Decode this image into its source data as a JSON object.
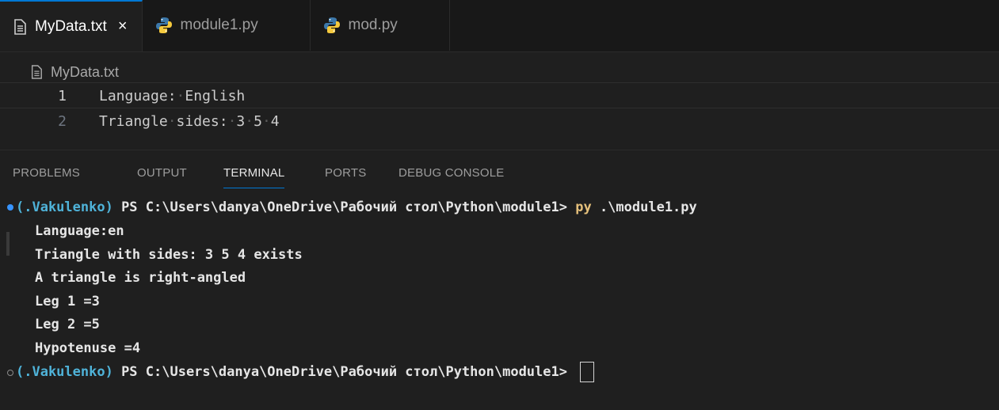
{
  "tabs": [
    {
      "label": "MyData.txt",
      "icon": "file-text-icon",
      "active": true,
      "close": "×"
    },
    {
      "label": "module1.py",
      "icon": "python-icon",
      "active": false
    },
    {
      "label": "mod.py",
      "icon": "python-icon",
      "active": false
    }
  ],
  "breadcrumb": {
    "file": "MyData.txt",
    "icon": "file-text-icon"
  },
  "editor": {
    "lines": [
      {
        "number": "1",
        "text": "Language: English"
      },
      {
        "number": "2",
        "text": "Triangle sides: 3 5 4"
      }
    ]
  },
  "panel": {
    "tabs": [
      "PROBLEMS",
      "OUTPUT",
      "TERMINAL",
      "PORTS",
      "DEBUG CONSOLE"
    ],
    "active_tab": "TERMINAL"
  },
  "terminal": {
    "prompt1": {
      "venv": "(.Vakulenko)",
      "path": " PS C:\\Users\\danya\\OneDrive\\Рабочий стол\\Python\\module1> ",
      "cmd": "py",
      "args": " .\\module1.py"
    },
    "output": [
      "Language:en",
      "Triangle with sides: 3 5 4 exists",
      "A triangle is right-angled",
      "Leg 1 =3",
      "Leg 2 =5",
      "Hypotenuse =4"
    ],
    "prompt2": {
      "venv": "(.Vakulenko)",
      "path": " PS C:\\Users\\danya\\OneDrive\\Рабочий стол\\Python\\module1> "
    }
  },
  "colors": {
    "accent": "#0078d4",
    "venv": "#4fb3d9",
    "command": "#e5c07b",
    "success_dot": "#3794ff"
  }
}
